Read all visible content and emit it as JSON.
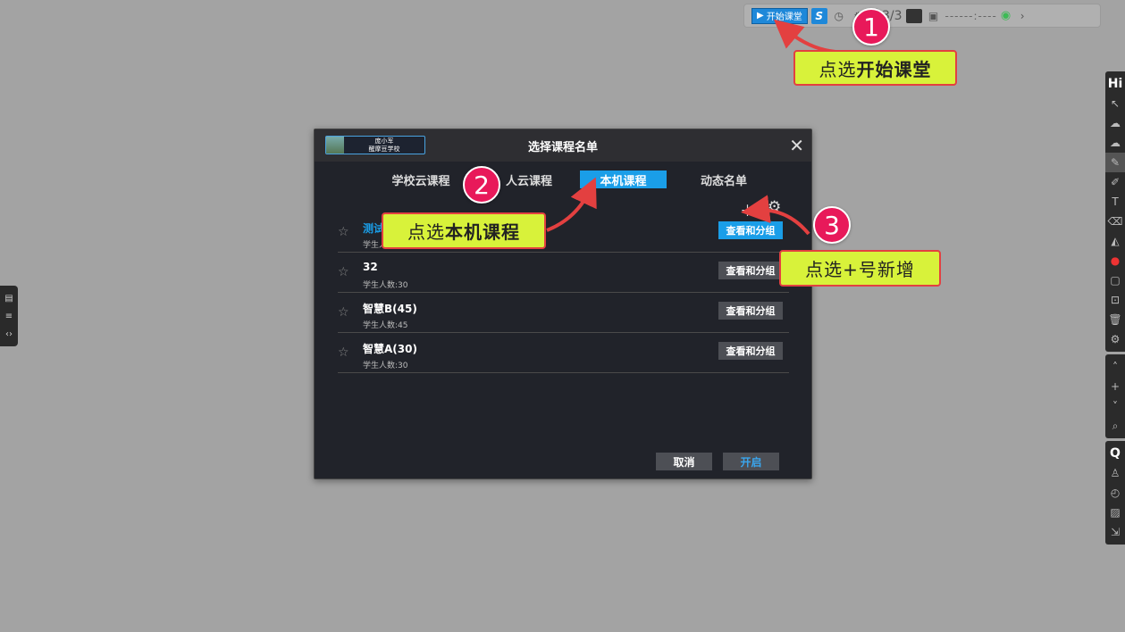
{
  "toolbar": {
    "start_label": "开始课堂",
    "page_indicator": "3/3",
    "time_display": "------:----"
  },
  "left_tab": {
    "icons": [
      "file-icon",
      "list-icon",
      "code-icon"
    ]
  },
  "right_bar": {
    "top_label": "Hi",
    "search_label": "Q"
  },
  "dialog": {
    "logo_line1": "庞小军",
    "logo_line2": "醒摩豆学校",
    "title": "选择课程名单",
    "close": "✕",
    "tabs": [
      {
        "label": "学校云课程",
        "active": false
      },
      {
        "label": "人云课程",
        "active": false
      },
      {
        "label": "本机课程",
        "active": true
      },
      {
        "label": "动态名单",
        "active": false
      }
    ],
    "courses": [
      {
        "name": "测试",
        "count": "学生人数:",
        "button": "查看和分组",
        "highlighted": true
      },
      {
        "name": "32",
        "count": "学生人数:30",
        "button": "查看和分组",
        "highlighted": false
      },
      {
        "name": "智慧B(45)",
        "count": "学生人数:45",
        "button": "查看和分组",
        "highlighted": false
      },
      {
        "name": "智慧A(30)",
        "count": "学生人数:30",
        "button": "查看和分组",
        "highlighted": false
      }
    ],
    "cancel_label": "取消",
    "open_label": "开启"
  },
  "callouts": {
    "c1_prefix": "点选",
    "c1_bold": "开始课堂",
    "c2_prefix": "点选",
    "c2_bold": "本机课程",
    "c3_text": "点选+号新增",
    "n1": "1",
    "n2": "2",
    "n3": "3"
  },
  "colors": {
    "accent": "#1a9ee8",
    "callout_bg": "#d8f23a",
    "callout_border": "#e34040",
    "badge": "#e8195a"
  }
}
